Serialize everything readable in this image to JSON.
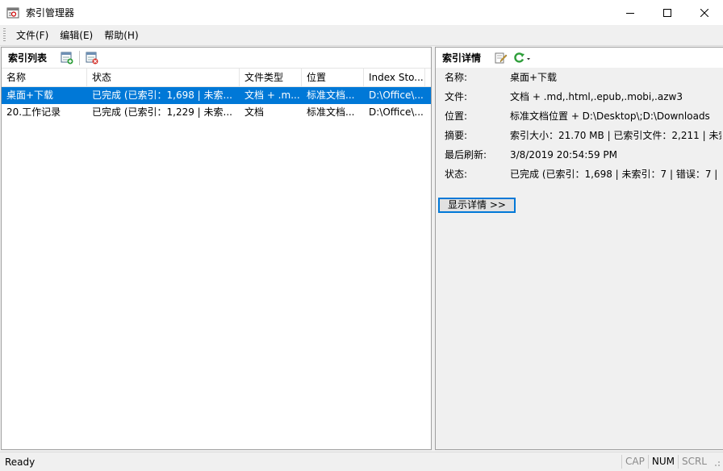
{
  "window": {
    "title": "索引管理器"
  },
  "menu": {
    "items": [
      "文件(F)",
      "编辑(E)",
      "帮助(H)"
    ]
  },
  "index_list": {
    "title": "索引列表",
    "columns": [
      "名称",
      "状态",
      "文件类型",
      "位置",
      "Index Sto..."
    ],
    "rows": [
      {
        "name": "桌面+下载",
        "status": "已完成 (已索引：1,698 | 未索...",
        "types": "文档 + .m...",
        "location": "标准文档...",
        "store": "D:\\Office\\...",
        "selected": true
      },
      {
        "name": "20.工作记录",
        "status": "已完成 (已索引：1,229 | 未索...",
        "types": "文档",
        "location": "标准文档...",
        "store": "D:\\Office\\...",
        "selected": false
      }
    ]
  },
  "details": {
    "title": "索引详情",
    "rows": [
      {
        "label": "名称:",
        "value": "桌面+下载"
      },
      {
        "label": "文件:",
        "value": "文档 + .md,.html,.epub,.mobi,.azw3"
      },
      {
        "label": "位置:",
        "value": "标准文档位置 + D:\\Desktop\\;D:\\Downloads"
      },
      {
        "label": "摘要:",
        "value": "索引大小：21.70 MB | 已索引文件：2,211 | 未索"
      },
      {
        "label": "最后刷新:",
        "value": "3/8/2019 20:54:59 PM"
      },
      {
        "label": "状态:",
        "value": "已完成 (已索引：1,698 | 未索引：7 | 错误：7 |"
      }
    ],
    "show_details_label": "显示详情 >>"
  },
  "statusbar": {
    "text": "Ready",
    "indicators": [
      "CAP",
      "NUM",
      "SCRL"
    ]
  },
  "colors": {
    "selection": "#0078d7",
    "accent_green": "#2e9e3a"
  }
}
